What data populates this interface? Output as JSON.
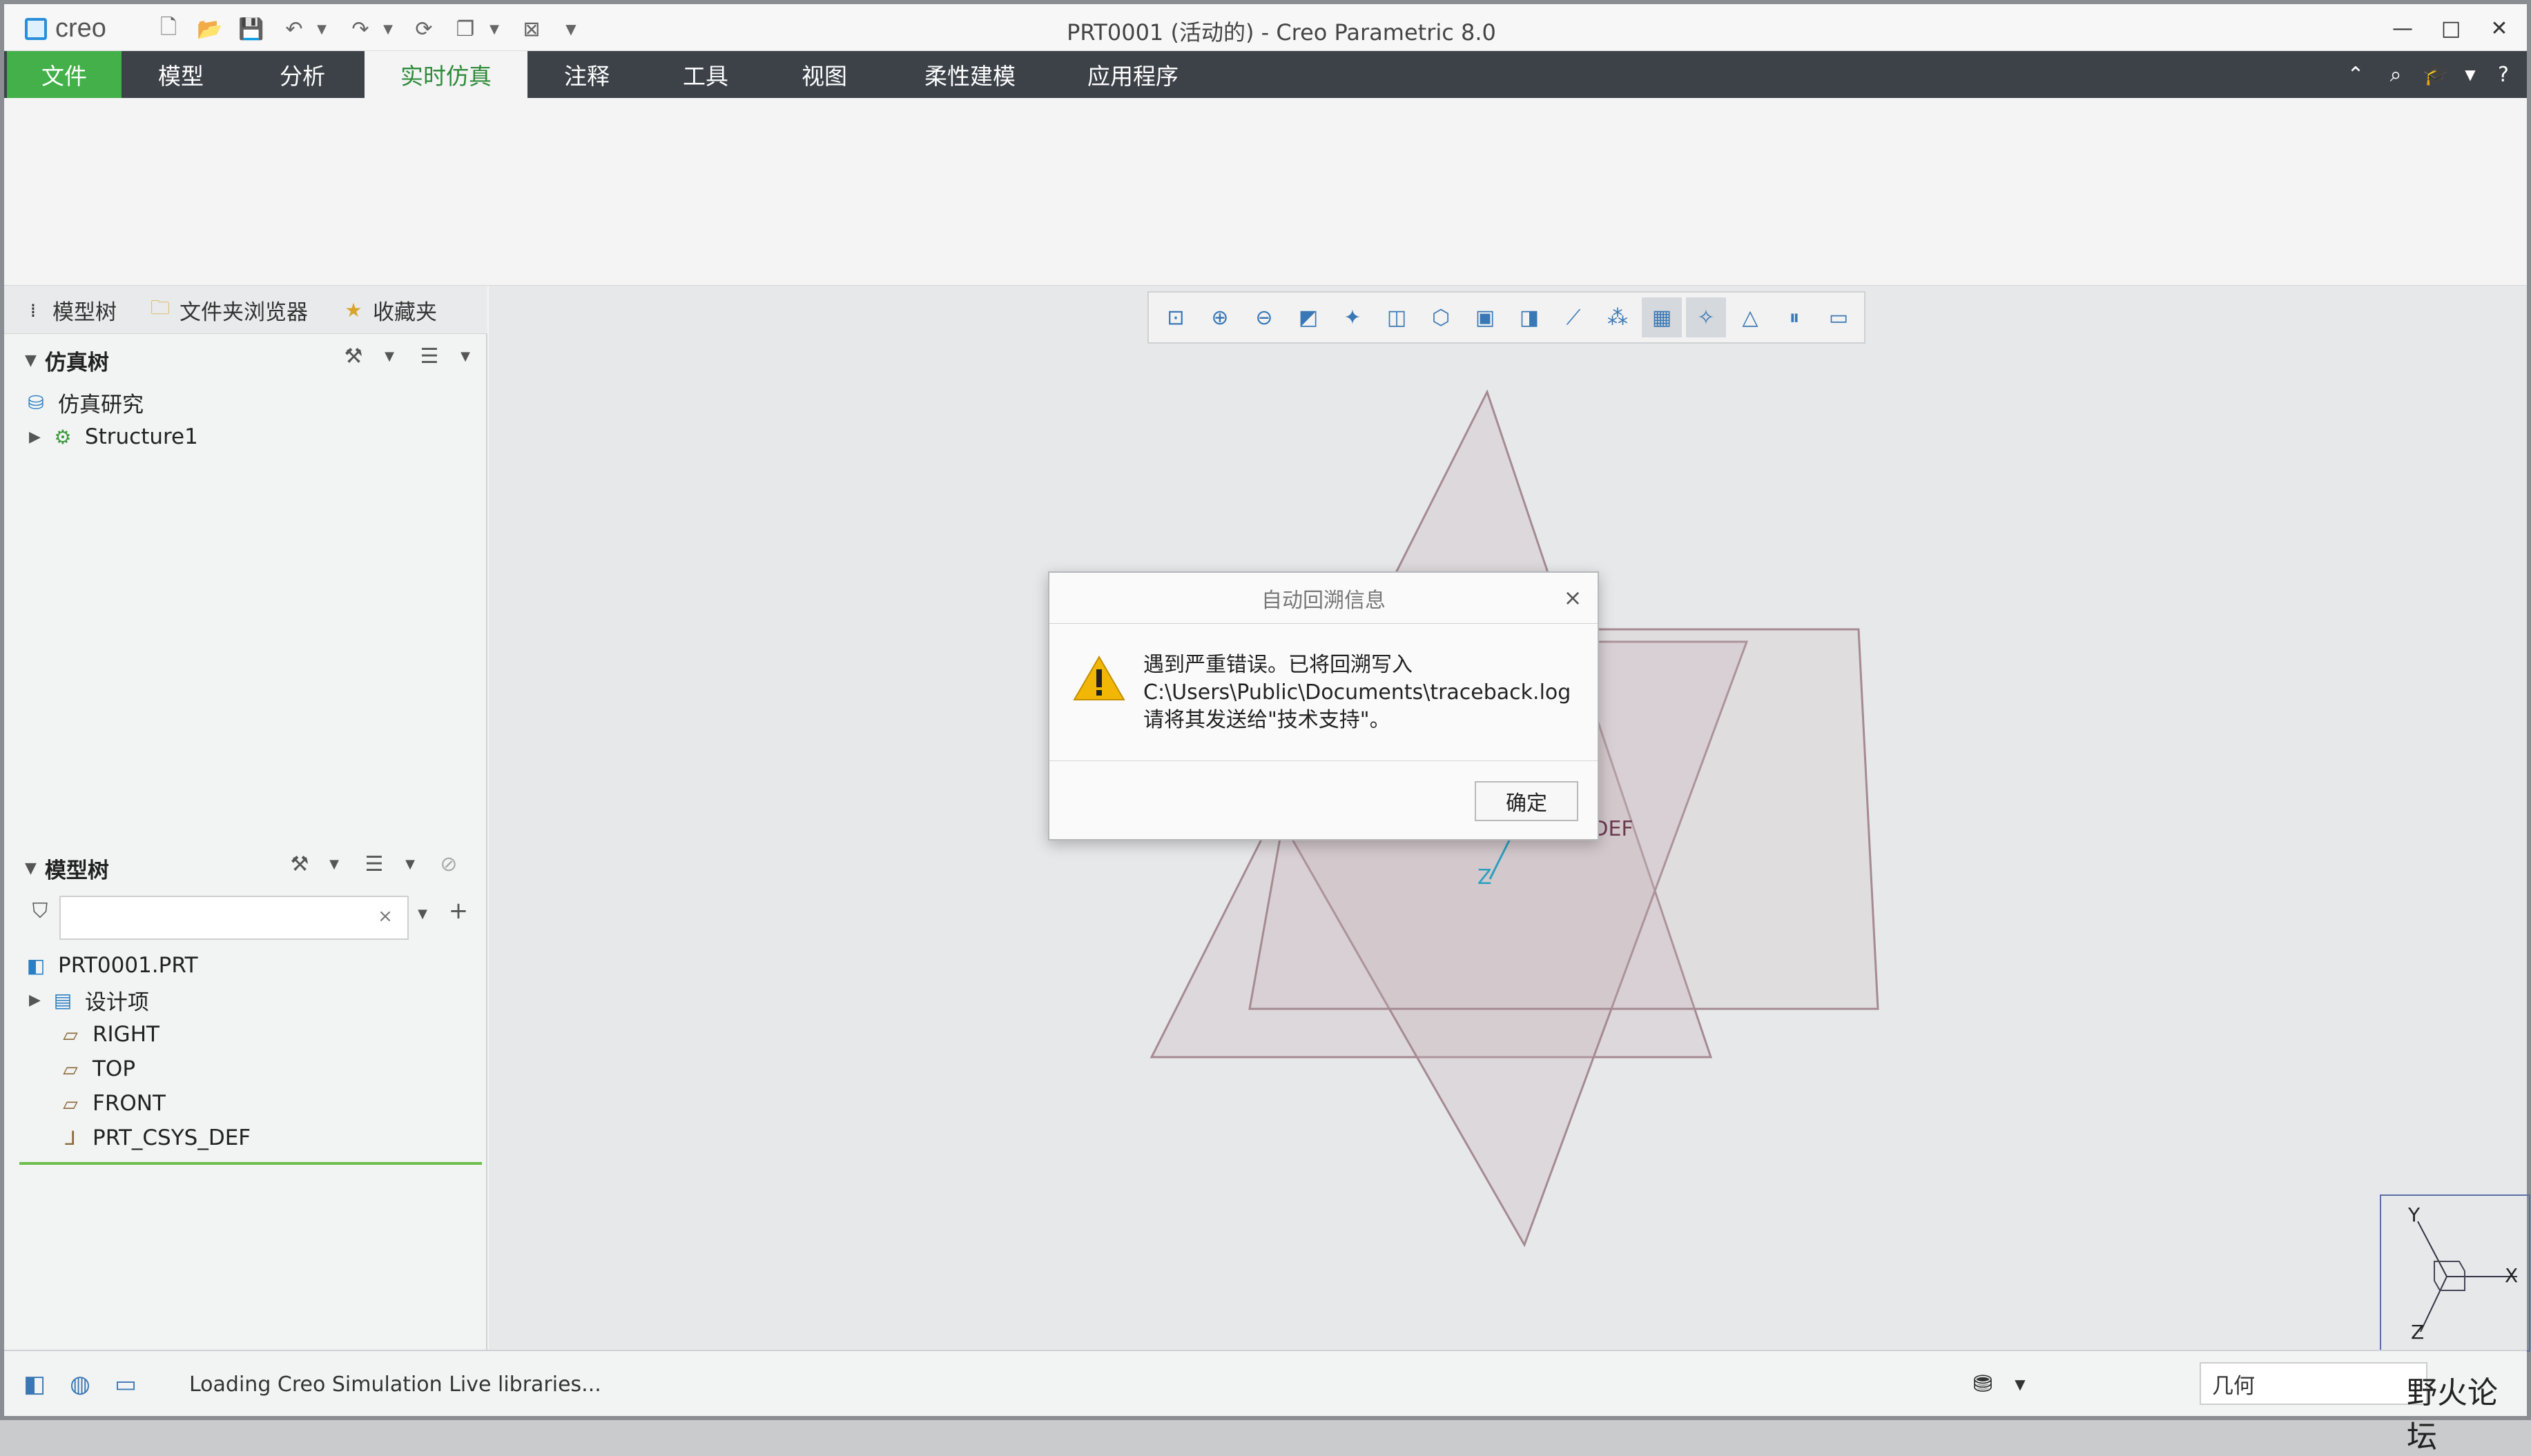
{
  "app": {
    "brand": "creo",
    "title": "PRT0001 (活动的) - Creo Parametric 8.0"
  },
  "window_buttons": {
    "minimize": "—",
    "maximize": "□",
    "close": "✕"
  },
  "tabs": [
    {
      "label": "文件"
    },
    {
      "label": "模型"
    },
    {
      "label": "分析"
    },
    {
      "label": "实时仿真"
    },
    {
      "label": "注释"
    },
    {
      "label": "工具"
    },
    {
      "label": "视图"
    },
    {
      "label": "柔性建模"
    },
    {
      "label": "应用程序"
    }
  ],
  "nav_tabs": [
    {
      "label": "模型树"
    },
    {
      "label": "文件夹浏览器"
    },
    {
      "label": "收藏夹"
    }
  ],
  "sim_tree": {
    "header": "仿真树",
    "items": [
      {
        "label": "仿真研究"
      },
      {
        "label": "Structure1"
      }
    ]
  },
  "model_tree": {
    "header": "模型树",
    "search_value": "",
    "items": [
      {
        "label": "PRT0001.PRT"
      },
      {
        "label": "设计项"
      },
      {
        "label": "RIGHT"
      },
      {
        "label": "TOP"
      },
      {
        "label": "FRONT"
      },
      {
        "label": "PRT_CSYS_DEF"
      }
    ]
  },
  "viewport": {
    "csys_label": "PRT_CSYS_DEF",
    "csys_visible_fragment": "YS_DEF",
    "axis_labels": {
      "x": "X",
      "y": "Y",
      "z": "Z"
    }
  },
  "dialog": {
    "title": "自动回溯信息",
    "close": "×",
    "lines": [
      "遇到严重错误。已将回溯写入",
      "C:\\Users\\Public\\Documents\\traceback.log",
      "请将其发送给\"技术支持\"。"
    ],
    "ok_label": "确定"
  },
  "status": {
    "message": "Loading Creo Simulation Live libraries...",
    "filter_value": "几何"
  },
  "watermark": "野火论坛",
  "colors": {
    "file_tab": "#43b049",
    "tab_bar": "#3d4249",
    "active_tab_text": "#2e8b3a",
    "tree_line": "#6cbf4b",
    "warning": "#f2b705"
  }
}
